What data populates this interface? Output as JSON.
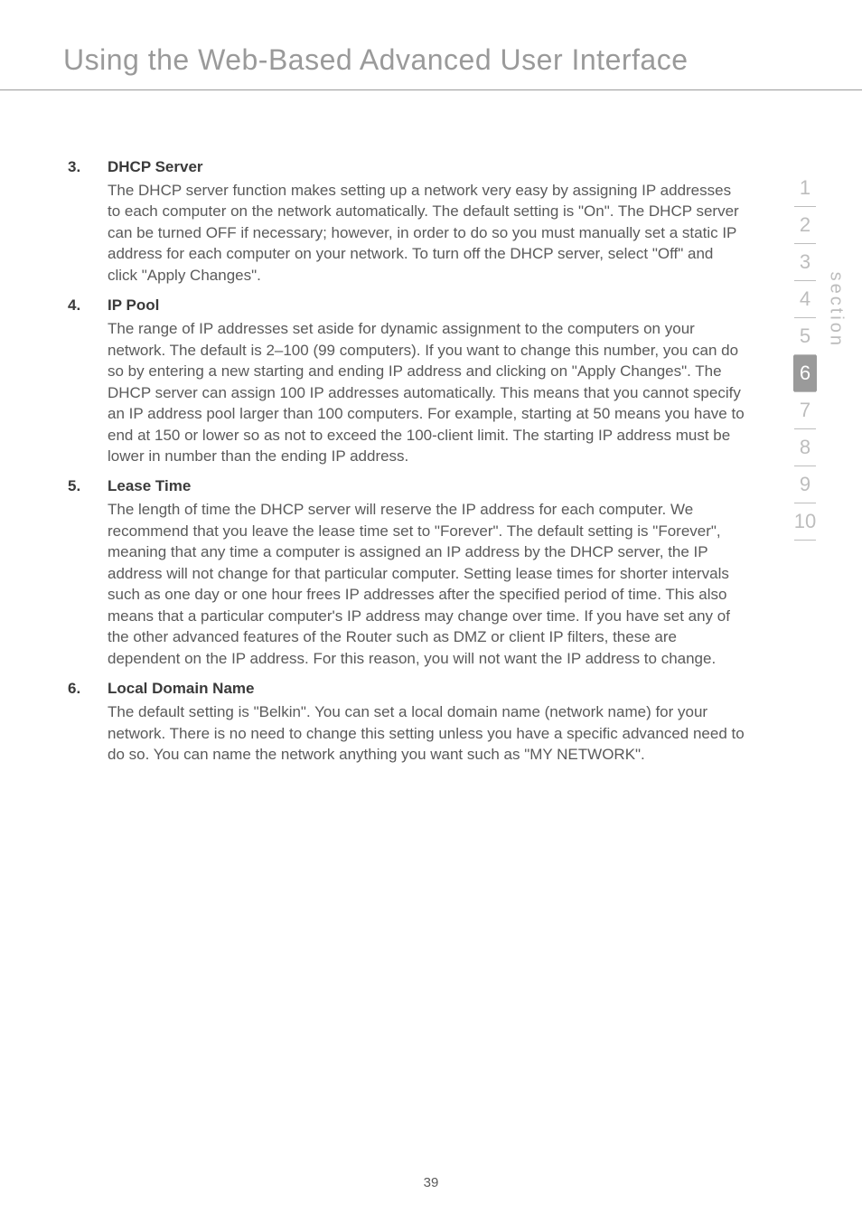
{
  "header": {
    "title": "Using the Web-Based Advanced User Interface"
  },
  "sections": [
    {
      "number": "3.",
      "heading": "DHCP Server",
      "text": "The DHCP server function makes setting up a network very easy by assigning IP addresses to each computer on the network automatically. The default setting is \"On\". The DHCP server can be turned OFF if necessary; however, in order to do so you must manually set a static IP address for each computer on your network. To turn off the DHCP server, select \"Off\" and click \"Apply Changes\"."
    },
    {
      "number": "4.",
      "heading": "IP Pool",
      "text": "The range of IP addresses set aside for dynamic assignment to the computers on your network. The default is 2–100 (99 computers). If you want to change this number, you can do so by entering a new starting and ending IP address and clicking on \"Apply Changes\". The DHCP server can assign 100 IP addresses automatically. This means that you cannot specify an IP address pool larger than 100 computers. For example, starting at 50 means you have to end at 150 or lower so as not to exceed the 100-client limit. The starting IP address must be lower in number than the ending IP address."
    },
    {
      "number": "5.",
      "heading": "Lease Time",
      "text": "The length of time the DHCP server will reserve the IP address for each computer. We recommend that you leave the lease time set to \"Forever\". The default setting is \"Forever\", meaning that any time a computer is assigned an IP address by the DHCP server, the IP address will not change for that particular computer. Setting lease times for shorter intervals such as one day or one hour frees IP addresses after the specified period of time. This also means that a particular computer's IP address may change over time. If you have set any of the other advanced features of the Router such as DMZ or client IP filters, these are dependent on the IP address. For this reason, you will not want the IP address to change."
    },
    {
      "number": "6.",
      "heading": "Local Domain Name",
      "text": "The default setting is \"Belkin\". You can set a local domain name (network name) for your network. There is no need to change this setting unless you have a specific advanced need to do so. You can name the network anything you want such as \"MY NETWORK\"."
    }
  ],
  "sidebar": {
    "items": [
      "1",
      "2",
      "3",
      "4",
      "5",
      "6",
      "7",
      "8",
      "9",
      "10"
    ],
    "active_index": 5,
    "label": "section"
  },
  "page_number": "39"
}
